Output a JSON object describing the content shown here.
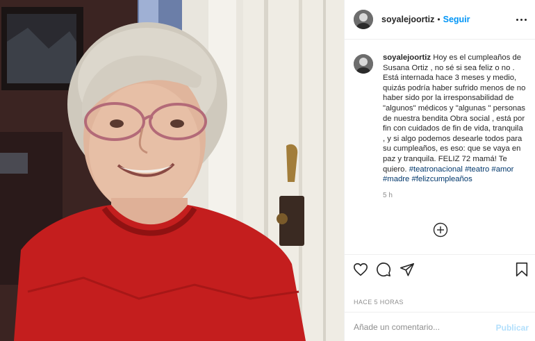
{
  "post": {
    "author": {
      "username": "soyalejoortiz",
      "follow_label": "Seguir",
      "separator": "•"
    },
    "caption": {
      "username": "soyalejoortiz",
      "text": "Hoy es el cumpleaños de Susana Ortiz , no sé si sea feliz o no . Está internada hace 3 meses y medio, quizás podría haber sufrido menos de no haber sido por la irresponsabilidad de \"algunos\" médicos y \"algunas \" personas de nuestra bendita Obra social , está por fin con cuidados de fin de vida, tranquila , y si algo podemos desearle todos para su cumpleaños, es eso: que se vaya en paz y tranquila. FELIZ 72 mamá! Te quiero.",
      "hashtags": [
        "#teatronacional",
        "#teatro",
        "#amor",
        "#madre",
        "#felizcumpleaños"
      ],
      "time_ago": "5 h"
    },
    "timestamp": "HACE 5 HORAS",
    "add_comment_placeholder": "Añade un comentario...",
    "publish_label": "Publicar"
  },
  "icons": {
    "more": "more-options-icon",
    "load_more": "plus-circle-icon",
    "like": "heart-icon",
    "comment": "comment-bubble-icon",
    "share": "paper-plane-icon",
    "save": "bookmark-icon"
  },
  "colors": {
    "follow_blue": "#0095f6",
    "hashtag_blue": "#00376b",
    "publish_disabled": "#b2dffc",
    "muted_text": "#8e8e8e",
    "sweater_red": "#c41e1e"
  }
}
